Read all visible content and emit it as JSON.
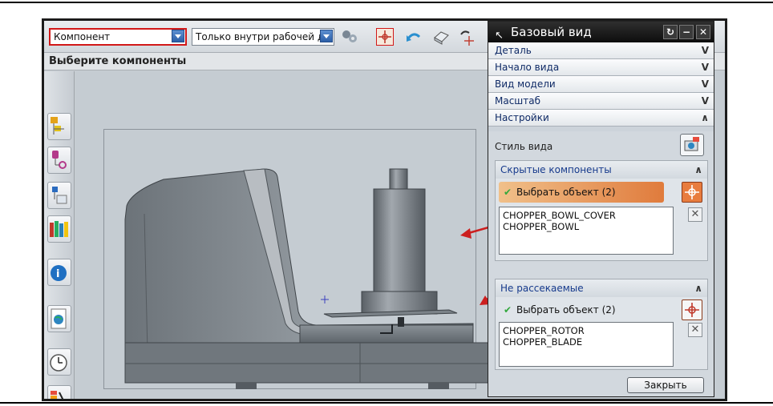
{
  "toolbar": {
    "component_select": "Компонент",
    "scope_select": "Только внутри рабочей д"
  },
  "status_prompt": "Выберите компоненты",
  "dialog": {
    "title": "Базовый вид",
    "sections": [
      {
        "label": "Деталь"
      },
      {
        "label": "Начало вида"
      },
      {
        "label": "Вид модели"
      },
      {
        "label": "Масштаб"
      }
    ],
    "settings_label": "Настройки",
    "view_style_label": "Стиль вида",
    "hidden_group": {
      "title": "Скрытые компоненты",
      "pick_label": "Выбрать объект (2)",
      "items": [
        "CHOPPER_BOWL_COVER",
        "CHOPPER_BOWL"
      ]
    },
    "nosection_group": {
      "title": "Не рассекаемые",
      "pick_label": "Выбрать объект (2)",
      "items": [
        "CHOPPER_ROTOR",
        "CHOPPER_BLADE"
      ]
    },
    "close_label": "Закрыть"
  },
  "colors": {
    "selection_red": "#d21818",
    "active_orange": "#e07b3c",
    "annotation_arrow": "#cc1f1f"
  }
}
